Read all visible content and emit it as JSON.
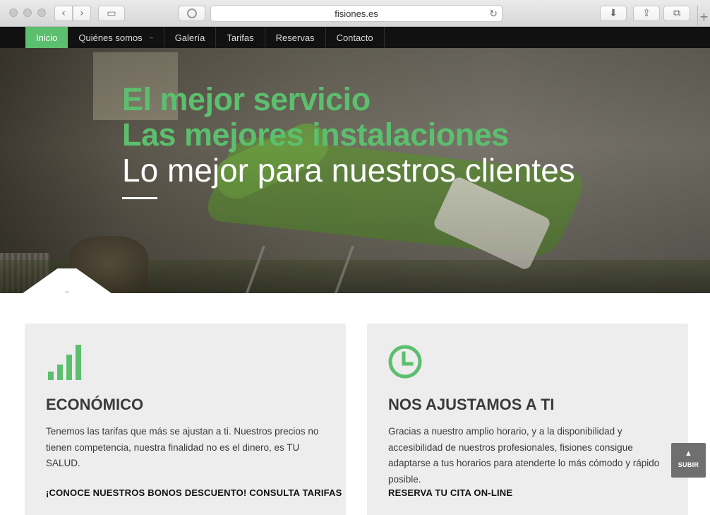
{
  "browser": {
    "url": "fisiones.es",
    "back_icon": "chevron-left-icon",
    "forward_icon": "chevron-right-icon"
  },
  "nav": {
    "items": [
      {
        "label": "Inicio",
        "active": true
      },
      {
        "label": "Quiénes somos",
        "has_submenu": true
      },
      {
        "label": "Galería"
      },
      {
        "label": "Tarifas"
      },
      {
        "label": "Reservas"
      },
      {
        "label": "Contacto"
      }
    ]
  },
  "hero": {
    "line1": "El mejor servicio",
    "line2": "Las mejores instalaciones",
    "line3": "Lo mejor para nuestros clientes"
  },
  "features": [
    {
      "icon": "signal-bars-icon",
      "title": "ECONÓMICO",
      "text": "Tenemos las tarifas que más se ajustan a ti. Nuestros precios no tienen competencia, nuestra finalidad no es el dinero, es TU SALUD.",
      "cta": "¡CONOCE NUESTROS BONOS DESCUENTO! CONSULTA TARIFAS"
    },
    {
      "icon": "clock-icon",
      "title": "NOS AJUSTAMOS A TI",
      "text": "Gracias a nuestro amplio horario, y a la disponibilidad y accesibilidad de nuestros profesionales, fisiones consigue adaptarse a tus horarios para atenderte lo más cómodo y rápido posible.",
      "cta": "RESERVA TU CITA ON-LINE"
    }
  ],
  "scroll_top": {
    "label": "SUBIR"
  },
  "colors": {
    "accent": "#5cbf6e",
    "nav_bg": "#111111",
    "card_bg": "#ededed"
  }
}
